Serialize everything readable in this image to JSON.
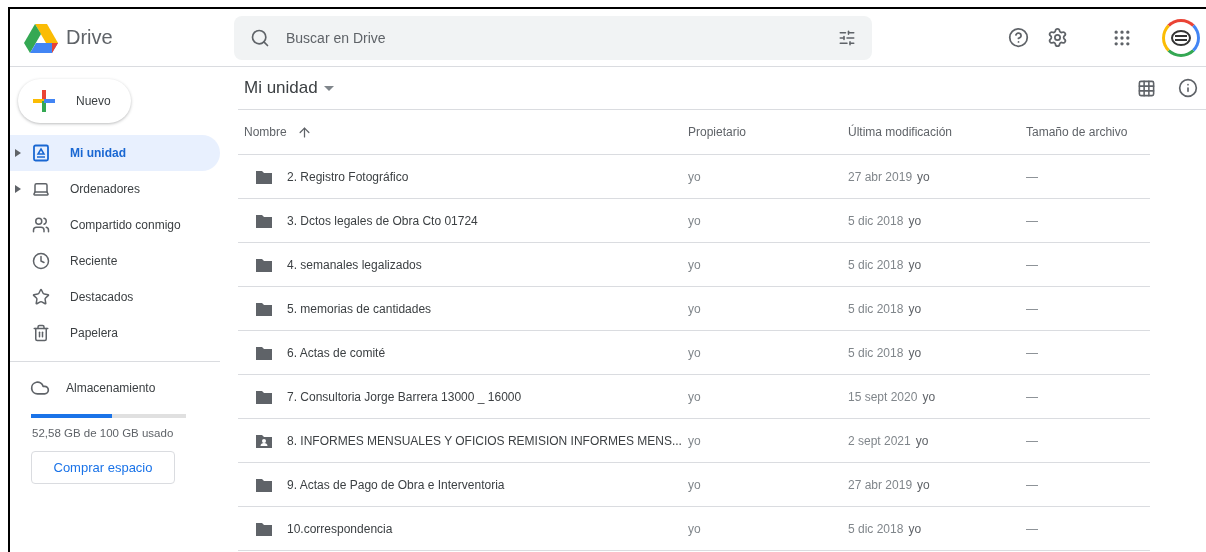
{
  "app": {
    "name": "Drive"
  },
  "search": {
    "placeholder": "Buscar en Drive"
  },
  "new_button": {
    "label": "Nuevo"
  },
  "sidebar": {
    "items": [
      {
        "label": "Mi unidad",
        "expandable": true,
        "selected": true
      },
      {
        "label": "Ordenadores",
        "expandable": true,
        "selected": false
      },
      {
        "label": "Compartido conmigo",
        "expandable": false,
        "selected": false
      },
      {
        "label": "Reciente",
        "expandable": false,
        "selected": false
      },
      {
        "label": "Destacados",
        "expandable": false,
        "selected": false
      },
      {
        "label": "Papelera",
        "expandable": false,
        "selected": false
      }
    ],
    "storage": {
      "label": "Almacenamiento",
      "level": 0.5258,
      "usage": "52,58 GB de 100 GB usado",
      "button": "Comprar espacio"
    }
  },
  "breadcrumb": {
    "title": "Mi unidad"
  },
  "table": {
    "columns": [
      "Nombre",
      "Propietario",
      "Última modificación",
      "Tamaño de archivo"
    ],
    "rows": [
      {
        "kind": "folder",
        "name": "2. Registro Fotográfico",
        "owner": "yo",
        "modified": "27 abr 2019",
        "modified_by": "yo",
        "size": "—"
      },
      {
        "kind": "folder",
        "name": "3. Dctos legales de Obra Cto 01724",
        "owner": "yo",
        "modified": "5 dic 2018",
        "modified_by": "yo",
        "size": "—"
      },
      {
        "kind": "folder",
        "name": "4. semanales legalizados",
        "owner": "yo",
        "modified": "5 dic 2018",
        "modified_by": "yo",
        "size": "—"
      },
      {
        "kind": "folder",
        "name": "5. memorias de cantidades",
        "owner": "yo",
        "modified": "5 dic 2018",
        "modified_by": "yo",
        "size": "—"
      },
      {
        "kind": "folder",
        "name": "6. Actas de comité",
        "owner": "yo",
        "modified": "5 dic 2018",
        "modified_by": "yo",
        "size": "—"
      },
      {
        "kind": "folder",
        "name": "7. Consultoria Jorge Barrera 13000 _ 16000",
        "owner": "yo",
        "modified": "15 sept 2020",
        "modified_by": "yo",
        "size": "—"
      },
      {
        "kind": "shared_folder",
        "name": "8. INFORMES MENSUALES Y OFICIOS REMISION INFORMES MENS...",
        "owner": "yo",
        "modified": "2 sept 2021",
        "modified_by": "yo",
        "size": "—"
      },
      {
        "kind": "folder",
        "name": "9. Actas de Pago de Obra e Interventoria",
        "owner": "yo",
        "modified": "27 abr 2019",
        "modified_by": "yo",
        "size": "—"
      },
      {
        "kind": "folder",
        "name": "10.correspondencia",
        "owner": "yo",
        "modified": "5 dic 2018",
        "modified_by": "yo",
        "size": "—"
      }
    ]
  }
}
